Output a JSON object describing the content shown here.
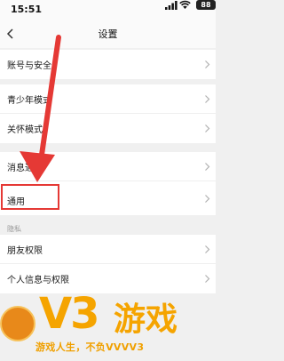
{
  "status_bar": {
    "time": "15:51",
    "battery": "88",
    "icons": [
      "signal-icon",
      "wifi-icon",
      "battery-icon"
    ]
  },
  "nav": {
    "title": "设置",
    "back_icon": "back-chevron-icon"
  },
  "groups": [
    {
      "items": [
        {
          "label": "账号与安全"
        }
      ]
    },
    {
      "items": [
        {
          "label": "青少年模式"
        },
        {
          "label": "关怀模式"
        }
      ]
    },
    {
      "items": [
        {
          "label": "消息通知"
        },
        {
          "label": "通用"
        }
      ]
    }
  ],
  "privacy_section": {
    "label": "隐私",
    "items": [
      {
        "label": "朋友权限"
      },
      {
        "label": "个人信息与权限"
      }
    ]
  },
  "annotation": {
    "highlight_color": "#e53935",
    "highlighted_item": "通用"
  },
  "watermark": {
    "brand": "V3",
    "brand_cn": "游戏",
    "slogan": "游戏人生，不负VVVV3"
  },
  "colors": {
    "background": "#f0f0f0",
    "card": "#ffffff",
    "accent_watermark": "#f5a400"
  }
}
